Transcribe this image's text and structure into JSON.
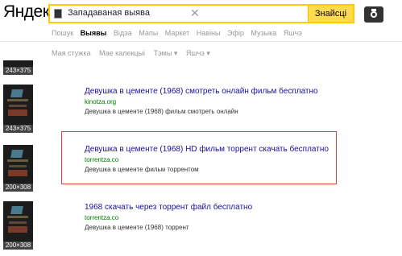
{
  "header": {
    "logo": "Яндекс",
    "search_value": "Западаваная выява",
    "search_button": "Знайсці"
  },
  "nav": {
    "tabs": [
      "Пошук",
      "Выявы",
      "Відэа",
      "Мапы",
      "Маркет",
      "Навіны",
      "Эфір",
      "Музыка",
      "Яшчэ"
    ]
  },
  "filters": [
    "Мая стужка",
    "Мае калекцыі",
    "Тэмы ▾",
    "Яшчэ ▾"
  ],
  "thumbs": [
    "243×375",
    "243×375",
    "200×308",
    "200×308"
  ],
  "results": [
    {
      "title": "Девушка в цементе (1968) смотреть онлайн фильм бесплатно",
      "url": "kinotza.org",
      "snippet": "Девушка в цементе (1968) фильм смотреть онлайн"
    },
    {
      "title": "Девушка в цементе (1968) HD фильм торрент скачать бесплатно",
      "url": "torrentza.co",
      "snippet": "Девушка в цементе фильм торрентом"
    },
    {
      "title": "1968 скачать через торрент файл бесплатно",
      "url": "torrentza.co",
      "snippet": "Девушка в цементе (1968) торрент"
    }
  ]
}
